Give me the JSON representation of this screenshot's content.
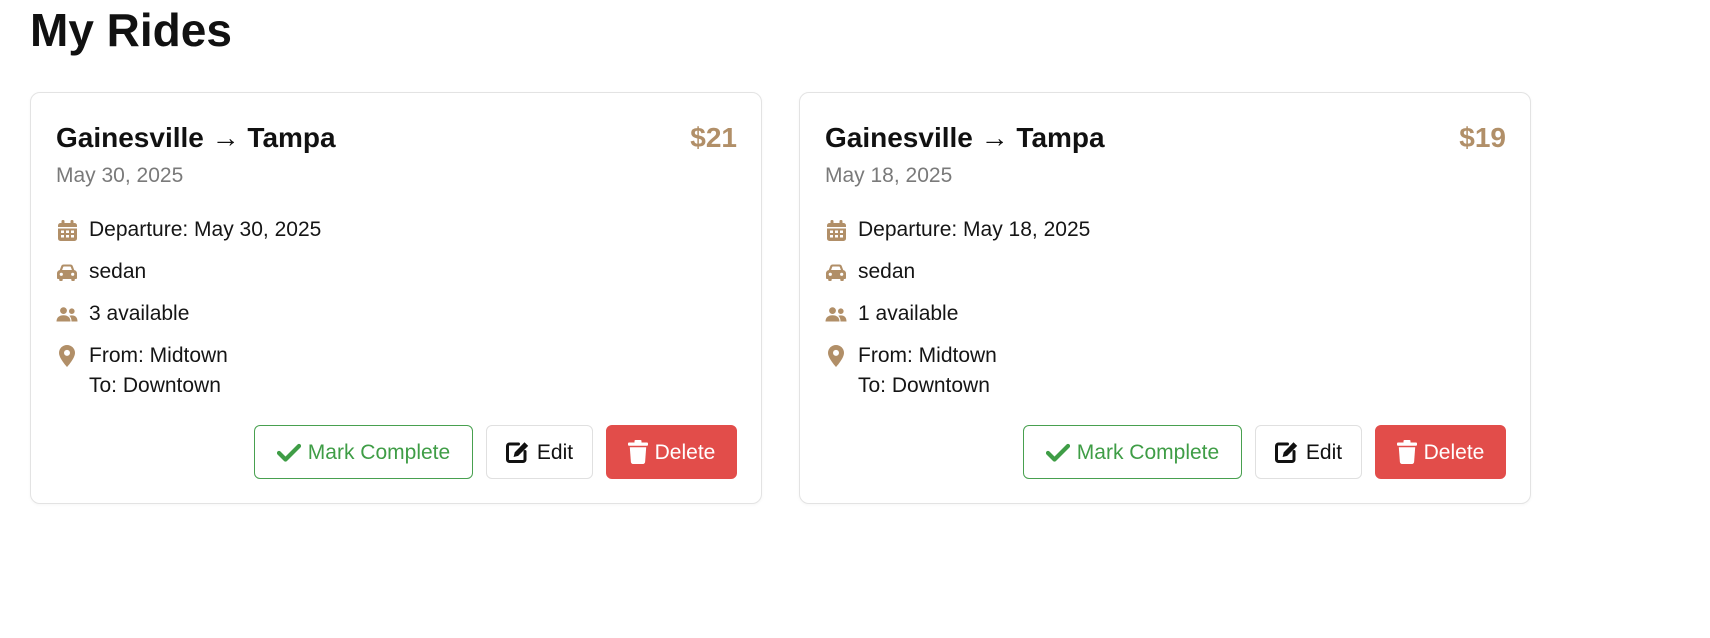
{
  "page": {
    "title": "My Rides"
  },
  "colors": {
    "accent": "#b18f68",
    "success": "#3f9d46",
    "danger": "#e24d4a"
  },
  "rides": [
    {
      "route": "Gainesville → Tampa",
      "price": "$21",
      "date": "May 30, 2025",
      "departure": "Departure: May 30, 2025",
      "vehicle": "sedan",
      "seats": "3 available",
      "from": "From: Midtown",
      "to": "To: Downtown",
      "actions": {
        "complete_label": "Mark Complete",
        "edit_label": "Edit",
        "delete_label": "Delete"
      },
      "icons": [
        "calendar-icon",
        "car-icon",
        "users-icon",
        "map-pin-icon",
        "check-icon",
        "edit-icon",
        "trash-icon"
      ]
    },
    {
      "route": "Gainesville → Tampa",
      "price": "$19",
      "date": "May 18, 2025",
      "departure": "Departure: May 18, 2025",
      "vehicle": "sedan",
      "seats": "1 available",
      "from": "From: Midtown",
      "to": "To: Downtown",
      "actions": {
        "complete_label": "Mark Complete",
        "edit_label": "Edit",
        "delete_label": "Delete"
      },
      "icons": [
        "calendar-icon",
        "car-icon",
        "users-icon",
        "map-pin-icon",
        "check-icon",
        "edit-icon",
        "trash-icon"
      ]
    }
  ]
}
